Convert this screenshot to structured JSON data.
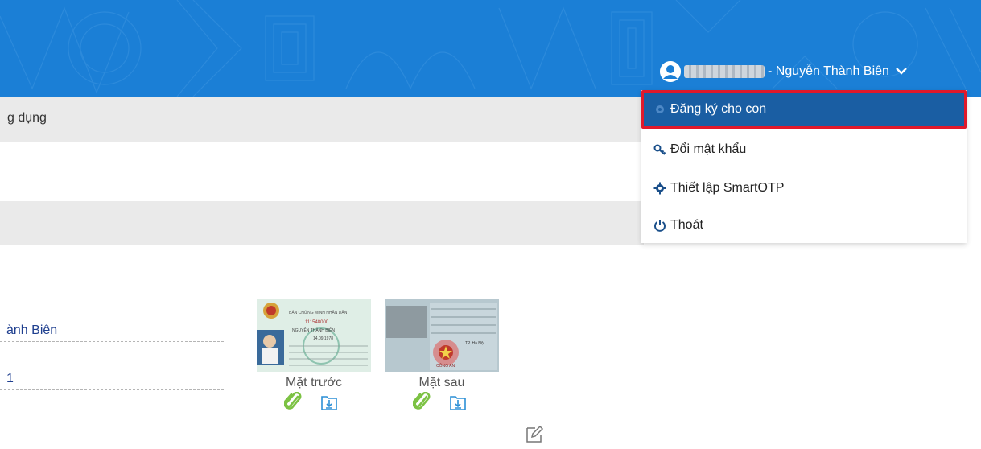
{
  "header": {
    "user_name": "- Nguyễn Thành Biên"
  },
  "breadcrumb": {
    "partial_text": "g dụng"
  },
  "dropdown": {
    "items": [
      {
        "label": "Đăng ký cho con",
        "icon": "gear-icon",
        "active": true
      },
      {
        "label": "Đổi mật khẩu",
        "icon": "key-icon"
      },
      {
        "label": "Thiết lập SmartOTP",
        "icon": "gear-icon"
      },
      {
        "label": "Thoát",
        "icon": "power-icon"
      }
    ]
  },
  "profile": {
    "name_partial": "ành Biên",
    "field2_partial": "1"
  },
  "documents": {
    "front_caption": "Mặt trước",
    "back_caption": "Mặt sau",
    "front_card": {
      "card_title": "BẢN CHỨNG MINH NHÂN DÂN",
      "card_number": "111548000",
      "card_name": "NGUYỄN THÀNH BIÊN",
      "card_dob": "14.09.1978"
    },
    "back_card": {
      "stamp_text": "CÔNG AN",
      "place": "TP. Hà Nội"
    }
  },
  "colors": {
    "header_blue": "#1b7fd6",
    "active_item_bg": "#1a5ea3",
    "highlight_border": "#e0192b",
    "grey_bar": "#eaeaea",
    "attach_green": "#7cc243",
    "download_blue": "#2b8fd6"
  }
}
